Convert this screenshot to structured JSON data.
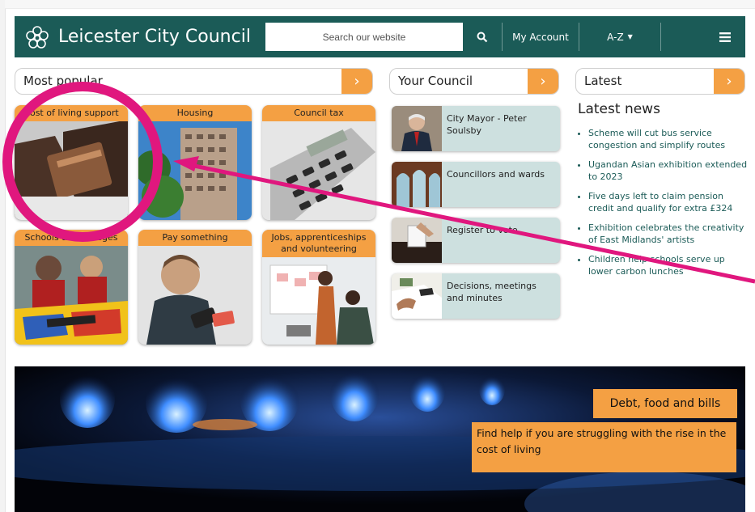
{
  "header": {
    "logo_text": "Leicester City Council",
    "search_placeholder": "Search our website",
    "my_account": "My Account",
    "az": "A-Z",
    "colors": {
      "header_bg": "#1b5b57",
      "accent": "#f4a043"
    }
  },
  "most_popular": {
    "title": "Most popular",
    "tiles": [
      {
        "label": "Cost of living support"
      },
      {
        "label": "Housing"
      },
      {
        "label": "Council tax"
      },
      {
        "label": "Schools and colleges"
      },
      {
        "label": "Pay something"
      },
      {
        "label": "Jobs, apprenticeships and volunteering"
      }
    ]
  },
  "your_council": {
    "title": "Your Council",
    "cards": [
      {
        "label": "City Mayor - Peter Soulsby"
      },
      {
        "label": "Councillors and wards"
      },
      {
        "label": "Register to vote"
      },
      {
        "label": "Decisions, meetings and minutes"
      }
    ]
  },
  "latest": {
    "title": "Latest",
    "heading": "Latest news",
    "items": [
      "Scheme will cut bus service congestion and simplify routes",
      "Ugandan Asian exhibition extended to 2023",
      "Five days left to claim pension credit and qualify for extra £324",
      "Exhibition celebrates the creativity of East Midlands' artists",
      "Children help schools serve up lower carbon lunches"
    ]
  },
  "banner": {
    "title": "Debt, food and bills",
    "text": "Find help if you are struggling with the rise in the cost of living"
  },
  "annotation": {
    "color": "#e0177e"
  }
}
